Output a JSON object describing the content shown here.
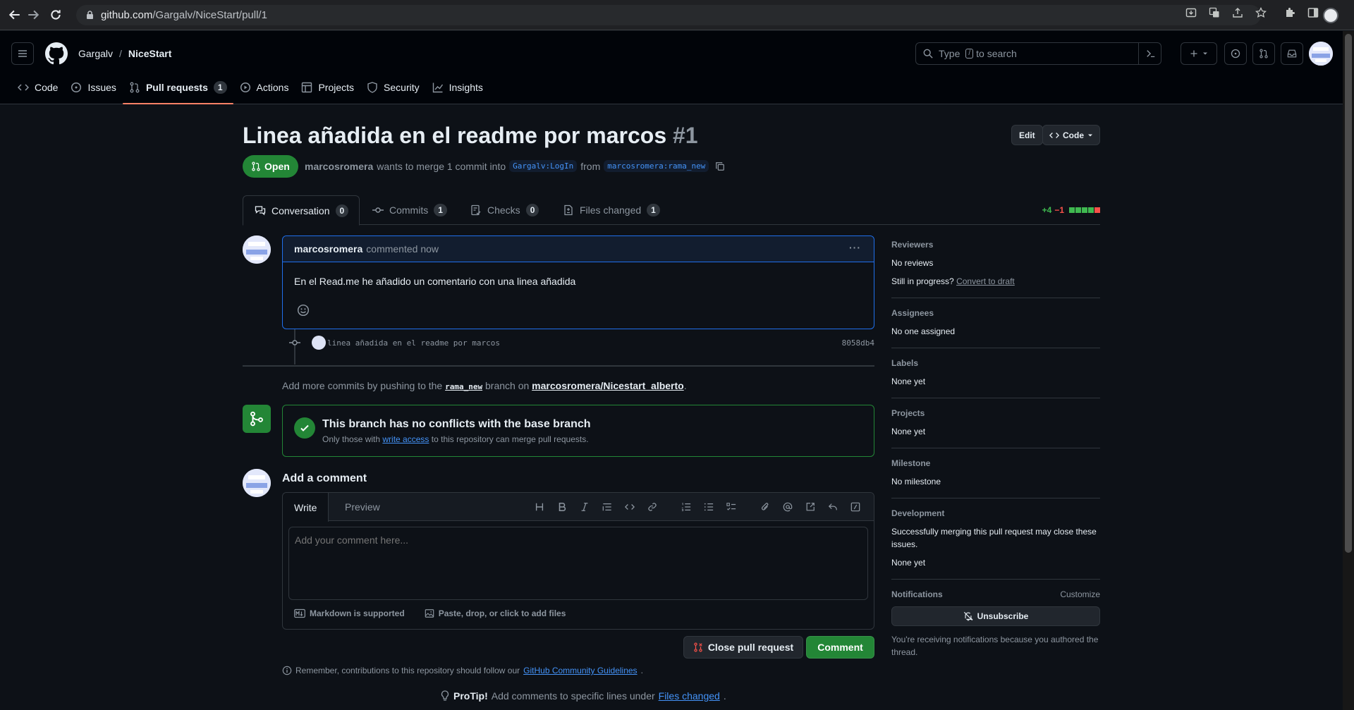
{
  "browser": {
    "url_domain": "github.com",
    "url_path": "/Gargalv/NiceStart/pull/1"
  },
  "header": {
    "owner": "Gargalv",
    "separator": "/",
    "repo": "NiceStart",
    "search_placeholder_pre": "Type",
    "search_kbd": "/",
    "search_placeholder_post": "to search"
  },
  "repo_nav": [
    {
      "label": "Code",
      "icon": "code-icon"
    },
    {
      "label": "Issues",
      "icon": "issue-opened-icon"
    },
    {
      "label": "Pull requests",
      "icon": "git-pull-request-icon",
      "count": "1",
      "selected": true
    },
    {
      "label": "Actions",
      "icon": "play-icon"
    },
    {
      "label": "Projects",
      "icon": "table-icon"
    },
    {
      "label": "Security",
      "icon": "shield-icon"
    },
    {
      "label": "Insights",
      "icon": "graph-icon"
    }
  ],
  "pr": {
    "title": "Linea añadida en el readme por marcos",
    "number": "#1",
    "edit_label": "Edit",
    "code_label": "Code",
    "state": "Open",
    "author": "marcosromera",
    "merge_text_1": "wants to merge 1 commit into",
    "base_branch": "Gargalv:LogIn",
    "from_text": "from",
    "head_branch": "marcosromera:rama_new"
  },
  "tabs": [
    {
      "label": "Conversation",
      "count": "0",
      "icon": "comment-discussion-icon"
    },
    {
      "label": "Commits",
      "count": "1",
      "icon": "git-commit-icon"
    },
    {
      "label": "Checks",
      "count": "0",
      "icon": "checklist-icon"
    },
    {
      "label": "Files changed",
      "count": "1",
      "icon": "file-diff-icon"
    }
  ],
  "diffstat": {
    "additions": "+4",
    "deletions": "−1"
  },
  "comment": {
    "author": "marcosromera",
    "when": "commented now",
    "body": "En el Read.me he añadido un comentario con una linea añadida",
    "menu": "···"
  },
  "commit": {
    "message": "linea añadida en el readme por marcos",
    "sha": "8058db4"
  },
  "push_hint": {
    "pre": "Add more commits by pushing to the",
    "branch": "rama_new",
    "mid": "branch on",
    "repo": "marcosromera/Nicestart_alberto",
    "post": "."
  },
  "merge": {
    "title": "This branch has no conflicts with the base branch",
    "sub_pre": "Only those with",
    "sub_link": "write access",
    "sub_post": "to this repository can merge pull requests."
  },
  "add_comment": {
    "title": "Add a comment",
    "tab_write": "Write",
    "tab_preview": "Preview",
    "placeholder": "Add your comment here...",
    "markdown": "Markdown is supported",
    "attach": "Paste, drop, or click to add files",
    "close_label": "Close pull request",
    "comment_label": "Comment"
  },
  "remember": {
    "pre": "Remember, contributions to this repository should follow our",
    "link": "GitHub Community Guidelines",
    "post": "."
  },
  "protip": {
    "label": "ProTip!",
    "pre": "Add comments to specific lines under",
    "link": "Files changed",
    "post": "."
  },
  "sidebar": {
    "reviewers_h": "Reviewers",
    "reviewers_v": "No reviews",
    "progress_pre": "Still in progress?",
    "progress_link": "Convert to draft",
    "assignees_h": "Assignees",
    "assignees_v": "No one assigned",
    "labels_h": "Labels",
    "labels_v": "None yet",
    "projects_h": "Projects",
    "projects_v": "None yet",
    "milestone_h": "Milestone",
    "milestone_v": "No milestone",
    "development_h": "Development",
    "development_desc": "Successfully merging this pull request may close these issues.",
    "development_v": "None yet",
    "notifications_h": "Notifications",
    "customize": "Customize",
    "unsubscribe": "Unsubscribe",
    "notif_note": "You're receiving notifications because you authored the thread."
  },
  "colors": {
    "accent": "#4493f8",
    "open": "#238636",
    "tab_underline": "#f78166",
    "bg": "#0d1117"
  }
}
